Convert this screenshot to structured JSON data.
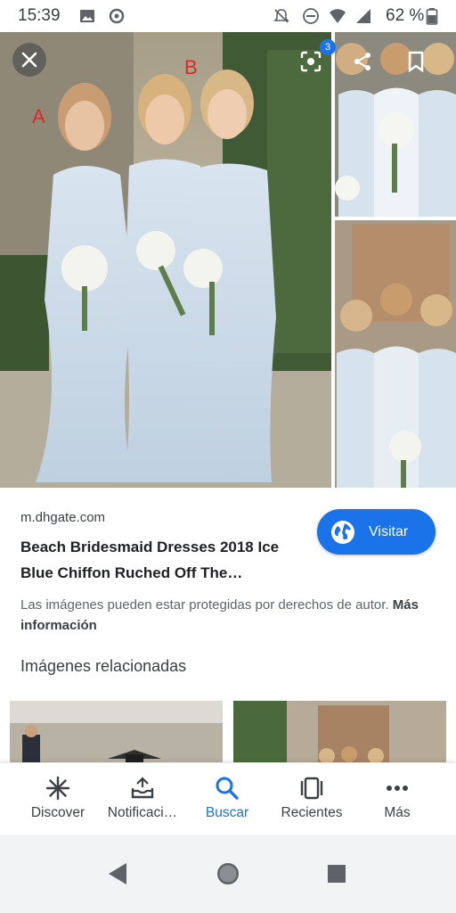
{
  "status_bar": {
    "time": "15:39",
    "battery_percent": "62 %",
    "icons": [
      "gallery-icon",
      "assistant-icon",
      "mute-icon",
      "dnd-icon",
      "wifi-icon",
      "signal-icon",
      "battery-icon"
    ]
  },
  "hero": {
    "close_icon": "close-icon",
    "lens_icon": "lens-icon",
    "lens_badge_count": "3",
    "share_icon": "share-icon",
    "save_icon": "bookmark-icon",
    "annotation_a": "A",
    "annotation_b": "B"
  },
  "result": {
    "source": "m.dhgate.com",
    "title": "Beach Bridesmaid Dresses 2018 Ice Blue Chiffon Ruched Off The…",
    "visit_label": "Visitar",
    "copyright_text": "Las imágenes pueden estar protegidas por derechos de autor.",
    "more_info_label": "Más información",
    "related_heading": "Imágenes relacionadas"
  },
  "bottom_nav": {
    "items": [
      {
        "label": "Discover",
        "icon": "discover-icon"
      },
      {
        "label": "Notificaci…",
        "icon": "notifications-icon"
      },
      {
        "label": "Buscar",
        "icon": "search-icon"
      },
      {
        "label": "Recientes",
        "icon": "recent-icon"
      },
      {
        "label": "Más",
        "icon": "more-icon"
      }
    ],
    "active_index": 2
  },
  "colors": {
    "accent": "#1a73e8",
    "text_primary": "#202124",
    "text_secondary": "#5f6368"
  }
}
